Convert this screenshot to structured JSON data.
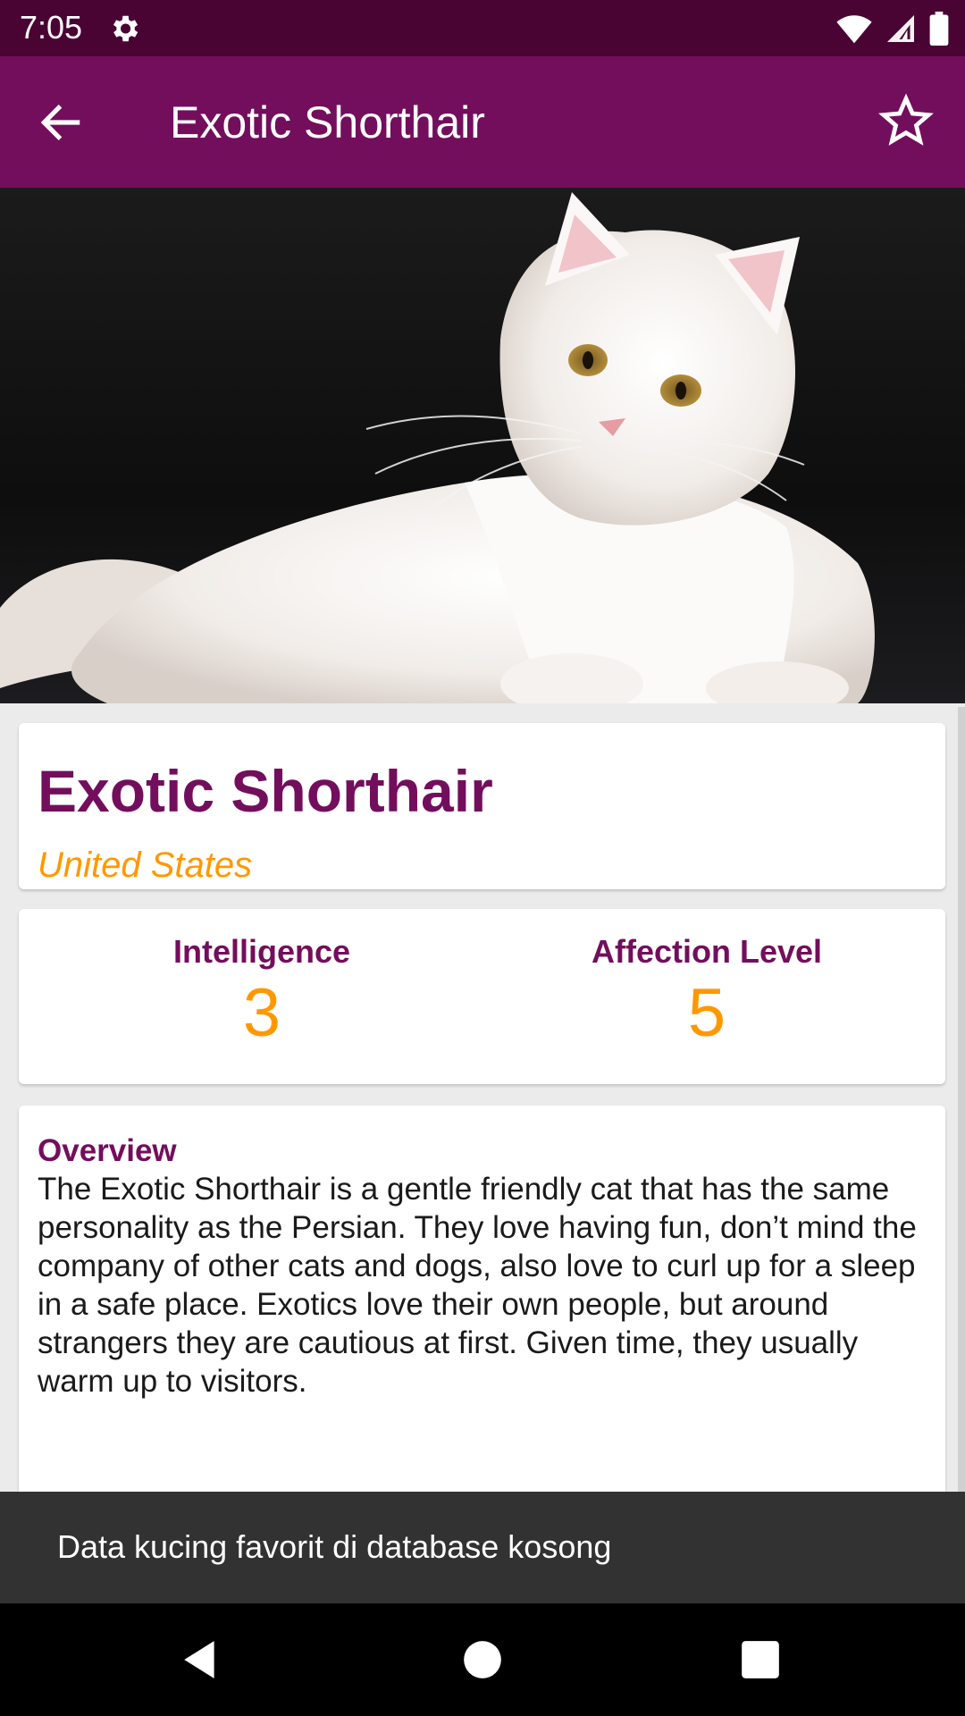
{
  "status_bar": {
    "time": "7:05",
    "icons": [
      "gear-icon",
      "wifi-icon",
      "signal-icon",
      "battery-icon"
    ]
  },
  "app_bar": {
    "title": "Exotic Shorthair",
    "back_icon": "arrow-back-icon",
    "favorite_icon": "star-outline-icon",
    "color": "#730e5d"
  },
  "hero": {
    "icon": "cat-photo"
  },
  "breed": {
    "name": "Exotic Shorthair",
    "origin": "United States"
  },
  "stats": {
    "intelligence_label": "Intelligence",
    "intelligence_value": "3",
    "affection_label": "Affection Level",
    "affection_value": "5"
  },
  "overview": {
    "label": "Overview",
    "text": "The Exotic Shorthair is a gentle friendly cat that has the same personality as the Persian. They love having fun, don’t mind the company of other cats and dogs, also love to curl up for a sleep in a safe place. Exotics love their own people, but around strangers they are cautious at first. Given time, they usually warm up to visitors."
  },
  "snackbar": {
    "message": "Data kucing favorit di database kosong"
  },
  "nav_bar": {
    "icons": [
      "back-triangle-icon",
      "home-circle-icon",
      "recents-square-icon"
    ]
  },
  "colors": {
    "primary": "#730e5d",
    "primary_dark": "#4a0433",
    "accent": "#ff9800"
  }
}
